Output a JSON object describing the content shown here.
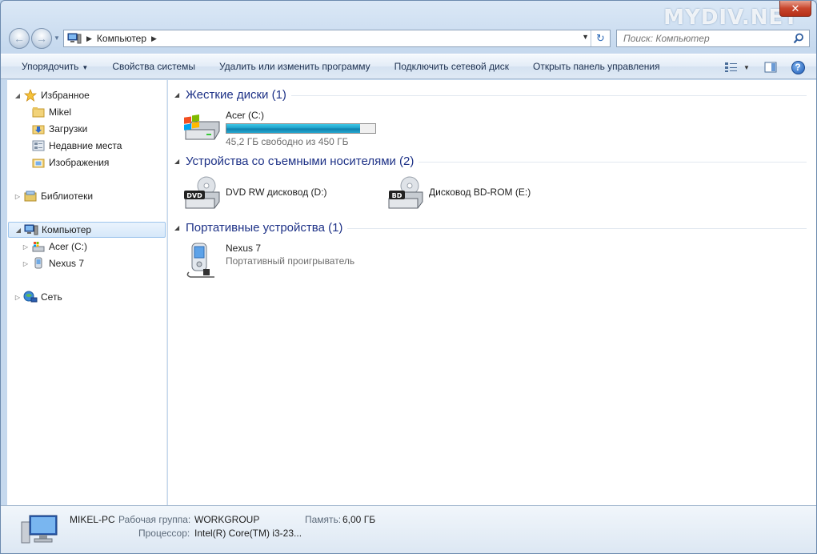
{
  "window": {
    "watermark": "MYDIV.NET",
    "close_glyph": "✕"
  },
  "address": {
    "path_item": "Компьютер",
    "refresh_glyph": "↻"
  },
  "search": {
    "placeholder": "Поиск: Компьютер"
  },
  "toolbar": {
    "organize": "Упорядочить",
    "system_properties": "Свойства системы",
    "uninstall": "Удалить или изменить программу",
    "map_drive": "Подключить сетевой диск",
    "control_panel": "Открыть панель управления",
    "help_glyph": "?"
  },
  "nav": {
    "favorites": "Избранное",
    "mikel": "Mikel",
    "downloads": "Загрузки",
    "recent": "Недавние места",
    "pictures": "Изображения",
    "libraries": "Библиотеки",
    "computer": "Компьютер",
    "acer": "Acer (C:)",
    "nexus": "Nexus 7",
    "network": "Сеть"
  },
  "groups": {
    "hdd": "Жесткие диски (1)",
    "removable": "Устройства со съемными носителями (2)",
    "portable": "Портативные устройства (1)"
  },
  "drives": {
    "c": {
      "name": "Acer (C:)",
      "free": "45,2 ГБ свободно из 450 ГБ",
      "used_fraction": 0.9
    },
    "dvd": {
      "name": "DVD RW дисковод (D:)",
      "badge": "DVD"
    },
    "bd": {
      "name": "Дисковод BD-ROM (E:)",
      "badge": "BD"
    },
    "nexus": {
      "name": "Nexus 7",
      "type": "Портативный проигрыватель"
    }
  },
  "details": {
    "pc_name": "MIKEL-PC",
    "workgroup_label": "Рабочая группа:",
    "workgroup_value": "WORKGROUP",
    "memory_label": "Память:",
    "memory_value": "6,00 ГБ",
    "cpu_label": "Процессор:",
    "cpu_value": "Intel(R) Core(TM) i3-23..."
  },
  "colors": {
    "accent": "#1e3287",
    "progress": "#1b9dc7",
    "selection": "#d6e8fa"
  }
}
